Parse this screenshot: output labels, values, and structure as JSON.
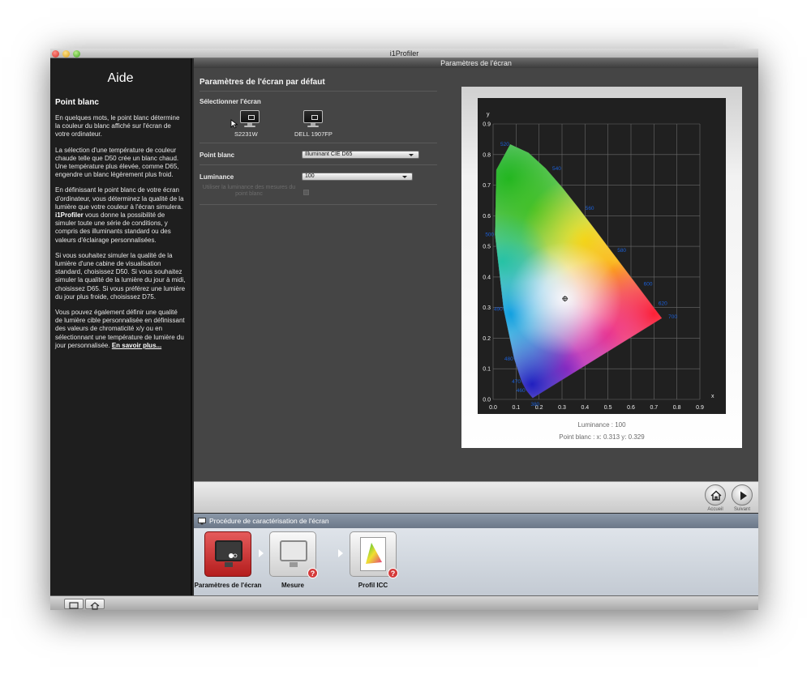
{
  "window": {
    "title": "i1Profiler"
  },
  "help": {
    "title": "Aide",
    "subtitle": "Point blanc",
    "paragraphs": [
      "En quelques mots, le point blanc détermine la couleur du blanc affiché sur l'écran de votre ordinateur.",
      "La sélection d'une température de couleur chaude telle que D50 crée un blanc chaud. Une température plus élevée, comme D65, engendre un blanc légèrement plus froid.",
      "Si vous souhaitez simuler la qualité de la lumière d'une cabine de visualisation standard, choisissez D50. Si vous souhaitez simuler la qualité de la lumière du jour à midi, choisissez D65. Si vous préférez une lumière du jour plus froide, choisissez D75."
    ],
    "para3_pre": "En définissant le point blanc de votre écran d'ordinateur, vous déterminez la qualité de la lumière que votre couleur à l'écran simulera. ",
    "para3_brand": "i1Profiler",
    "para3_post": " vous donne la possibilité de simuler toute une série de conditions, y compris des illuminants standard ou des valeurs d'éclairage personnalisées.",
    "para5": "Vous pouvez également définir une qualité de lumière cible personnalisée en définissant des valeurs de chromaticité x/y ou en sélectionnant une température de lumière du jour personnalisée. ",
    "learn_more": "En savoir plus..."
  },
  "main": {
    "header": "Paramètres de l'écran",
    "section_title": "Paramètres de l'écran par défaut",
    "select_screen_label": "Sélectionner l'écran",
    "monitors": [
      "S2231W",
      "DELL 1907FP"
    ],
    "white_point_label": "Point blanc",
    "white_point_value": "Illuminant CIE D65",
    "luminance_label": "Luminance",
    "luminance_value": "100",
    "measured_luminance_label": "Utiliser la luminance des mesures du point blanc"
  },
  "chart_info": {
    "luminance": "Luminance : 100",
    "white_point": "Point blanc : x: 0.313  y: 0.329"
  },
  "chart_data": {
    "type": "scatter",
    "xlabel": "x",
    "ylabel": "y",
    "xlim": [
      0.0,
      0.9
    ],
    "ylim": [
      0.0,
      0.9
    ],
    "x_ticks": [
      "0.0",
      "0.1",
      "0.2",
      "0.3",
      "0.4",
      "0.5",
      "0.6",
      "0.7",
      "0.8",
      "0.9"
    ],
    "y_ticks": [
      "0.0",
      "0.1",
      "0.2",
      "0.3",
      "0.4",
      "0.5",
      "0.6",
      "0.7",
      "0.8",
      "0.9"
    ],
    "grid": true,
    "locus": [
      [
        0.1741,
        0.005
      ],
      [
        0.1738,
        0.0049
      ],
      [
        0.1726,
        0.0048
      ],
      [
        0.1714,
        0.0051
      ],
      [
        0.1689,
        0.0069
      ],
      [
        0.1644,
        0.0109
      ],
      [
        0.1566,
        0.0177
      ],
      [
        0.144,
        0.0297
      ],
      [
        0.1241,
        0.0578
      ],
      [
        0.0913,
        0.1327
      ],
      [
        0.0454,
        0.295
      ],
      [
        0.0082,
        0.5384
      ],
      [
        0.0139,
        0.7502
      ],
      [
        0.0743,
        0.8338
      ],
      [
        0.1547,
        0.8059
      ],
      [
        0.2296,
        0.7543
      ],
      [
        0.3016,
        0.6923
      ],
      [
        0.3731,
        0.6245
      ],
      [
        0.4441,
        0.5547
      ],
      [
        0.5125,
        0.4866
      ],
      [
        0.5752,
        0.4242
      ],
      [
        0.627,
        0.3725
      ],
      [
        0.6658,
        0.334
      ],
      [
        0.6915,
        0.3083
      ],
      [
        0.7079,
        0.292
      ],
      [
        0.719,
        0.2809
      ],
      [
        0.726,
        0.274
      ],
      [
        0.73,
        0.27
      ],
      [
        0.7347,
        0.2653
      ]
    ],
    "wavelength_labels": [
      {
        "label": "380",
        "x": 0.1741,
        "y": 0.005
      },
      {
        "label": "460",
        "x": 0.144,
        "y": 0.0297
      },
      {
        "label": "470",
        "x": 0.1241,
        "y": 0.0578
      },
      {
        "label": "480",
        "x": 0.0913,
        "y": 0.1327
      },
      {
        "label": "490",
        "x": 0.0454,
        "y": 0.295
      },
      {
        "label": "500",
        "x": 0.0082,
        "y": 0.5384
      },
      {
        "label": "520",
        "x": 0.0743,
        "y": 0.8338
      },
      {
        "label": "540",
        "x": 0.2296,
        "y": 0.7543
      },
      {
        "label": "560",
        "x": 0.3731,
        "y": 0.6245
      },
      {
        "label": "580",
        "x": 0.5125,
        "y": 0.4866
      },
      {
        "label": "600",
        "x": 0.627,
        "y": 0.3725
      },
      {
        "label": "620",
        "x": 0.6915,
        "y": 0.3083
      },
      {
        "label": "700",
        "x": 0.7347,
        "y": 0.2653
      }
    ],
    "white_point": {
      "x": 0.313,
      "y": 0.329
    }
  },
  "footer": {
    "home_label": "Accueil",
    "next_label": "Suivant"
  },
  "procedure": {
    "title": "Procédure de caractérisation de l'écran",
    "steps": [
      "Paramètres de l'écran",
      "Mesure",
      "Profil ICC"
    ]
  }
}
